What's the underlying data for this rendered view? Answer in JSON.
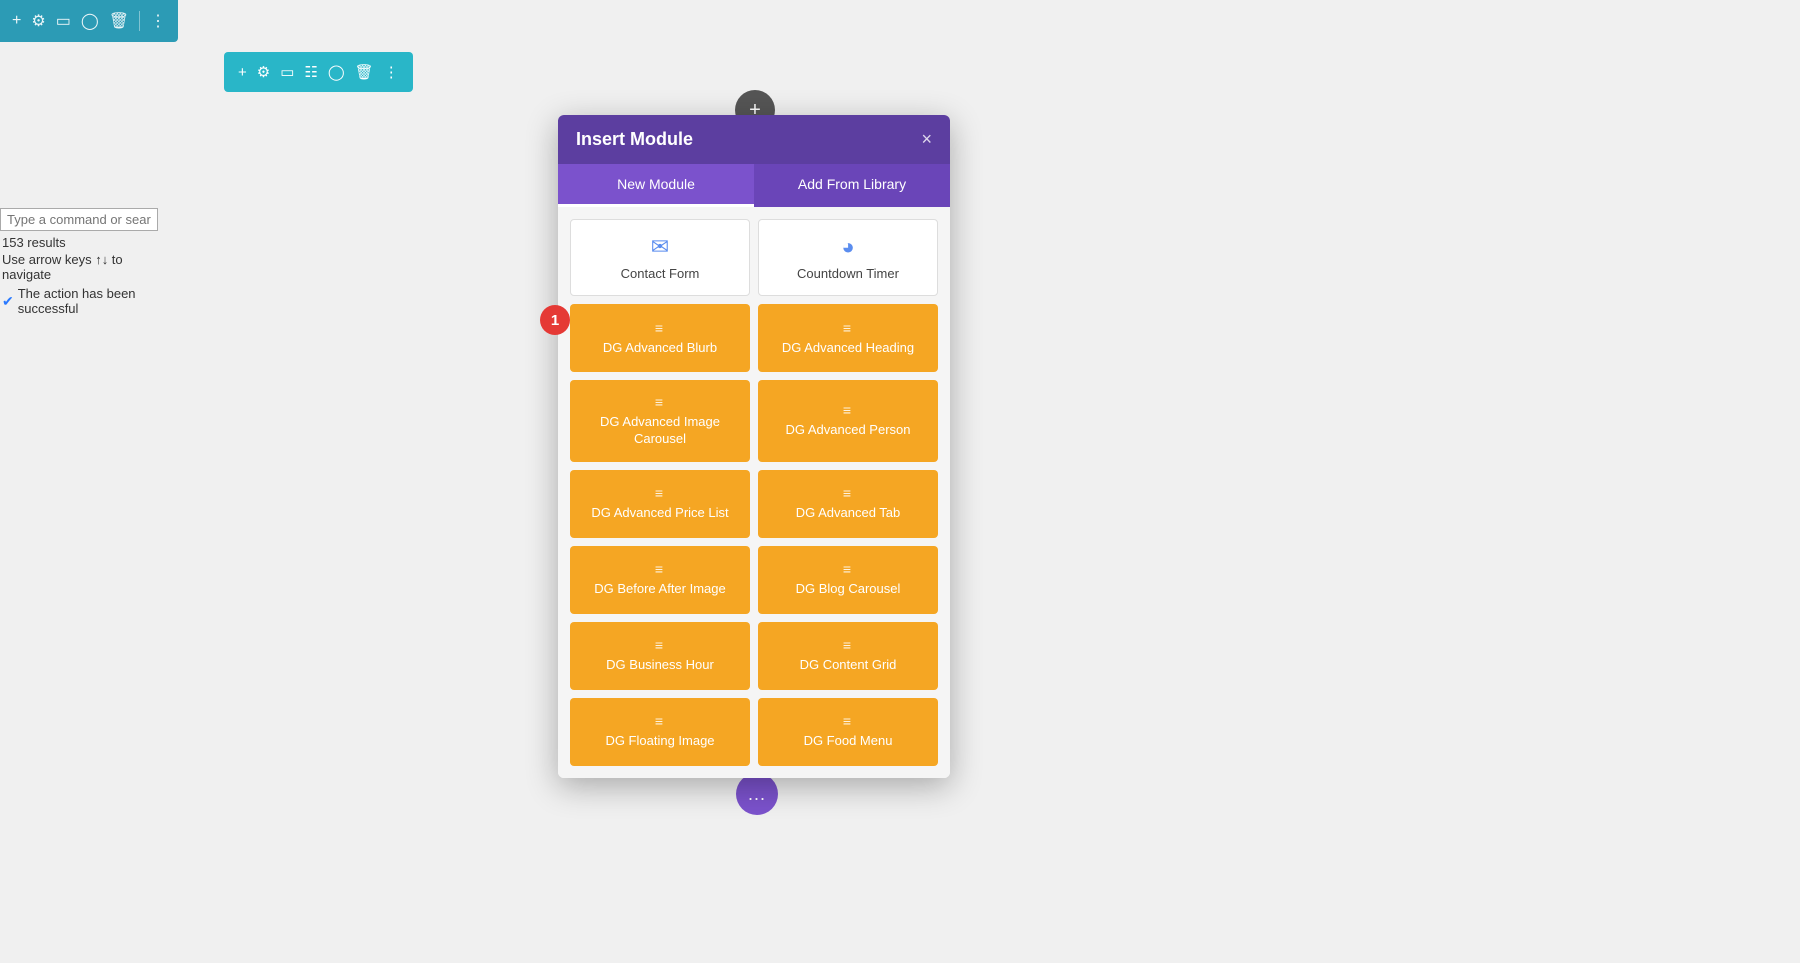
{
  "topToolbar": {
    "icons": [
      "plus",
      "gear",
      "window",
      "power",
      "trash",
      "dots"
    ]
  },
  "secondaryToolbar": {
    "icons": [
      "plus",
      "gear",
      "window",
      "grid",
      "power",
      "trash",
      "dots"
    ]
  },
  "search": {
    "placeholder": "Type a command or sear",
    "results": "153 results",
    "nav": "Use arrow keys ↑↓ to navigate",
    "success": "The action has been successful"
  },
  "modal": {
    "title": "Insert Module",
    "close": "×",
    "tabs": [
      {
        "label": "New Module",
        "active": true
      },
      {
        "label": "Add From Library",
        "active": false
      }
    ],
    "whiteModules": [
      {
        "label": "Contact Form",
        "iconType": "envelope"
      },
      {
        "label": "Countdown Timer",
        "iconType": "power"
      }
    ],
    "orangeModules": [
      {
        "label": "DG Advanced Blurb"
      },
      {
        "label": "DG Advanced Heading"
      },
      {
        "label": "DG Advanced Image Carousel"
      },
      {
        "label": "DG Advanced Person"
      },
      {
        "label": "DG Advanced Price List"
      },
      {
        "label": "DG Advanced Tab"
      },
      {
        "label": "DG Before After Image"
      },
      {
        "label": "DG Blog Carousel"
      },
      {
        "label": "DG Business Hour"
      },
      {
        "label": "DG Content Grid"
      },
      {
        "label": "DG Floating Image"
      },
      {
        "label": "DG Food Menu"
      }
    ]
  },
  "badge": "1",
  "addRowBtn": "+",
  "bottomFab": "..."
}
